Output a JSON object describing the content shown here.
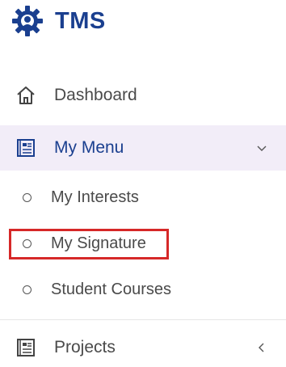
{
  "brand": {
    "title": "TMS",
    "logo_icon": "gear-emblem-icon",
    "title_color": "#1a3f8f"
  },
  "nav": {
    "dashboard": {
      "label": "Dashboard",
      "icon": "home-icon"
    },
    "my_menu": {
      "label": "My Menu",
      "icon": "document-list-icon",
      "expanded": true,
      "chevron": "chevron-down-icon",
      "active_background": "#f2edf8",
      "submenu": [
        {
          "label": "My Interests"
        },
        {
          "label": "My Signature",
          "highlighted": true
        },
        {
          "label": "Student Courses"
        }
      ]
    },
    "projects": {
      "label": "Projects",
      "icon": "document-list-icon",
      "chevron": "chevron-left-icon"
    }
  },
  "highlight_color": "#d62828"
}
